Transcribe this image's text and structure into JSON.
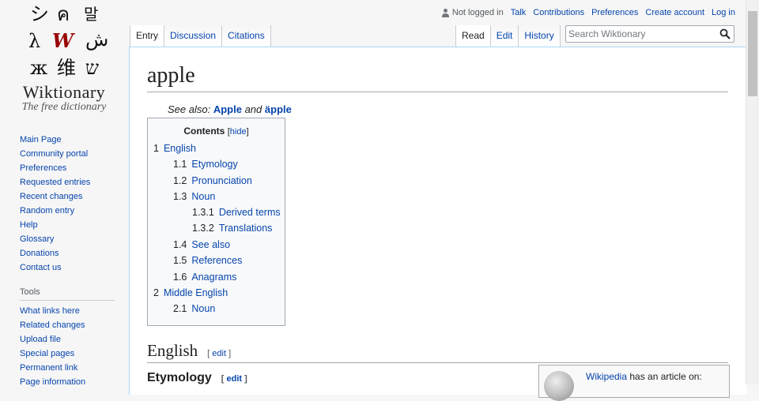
{
  "logo": {
    "glyphs": [
      "シ",
      "ค",
      "말",
      "λ",
      "W",
      "ش",
      "ж",
      "维",
      "ש"
    ],
    "wordmark": "Wiktionary",
    "tagline": "The free dictionary"
  },
  "sidebar": {
    "nav": [
      "Main Page",
      "Community portal",
      "Preferences",
      "Requested entries",
      "Recent changes",
      "Random entry",
      "Help",
      "Glossary",
      "Donations",
      "Contact us"
    ],
    "tools_heading": "Tools",
    "tools": [
      "What links here",
      "Related changes",
      "Upload file",
      "Special pages",
      "Permanent link",
      "Page information"
    ]
  },
  "personal": {
    "not_logged_in": "Not logged in",
    "talk": "Talk",
    "contributions": "Contributions",
    "preferences": "Preferences",
    "create_account": "Create account",
    "log_in": "Log in"
  },
  "tabs": {
    "left": [
      "Entry",
      "Discussion",
      "Citations"
    ],
    "right": [
      "Read",
      "Edit",
      "History"
    ]
  },
  "search": {
    "placeholder": "Search Wiktionary"
  },
  "page": {
    "title": "apple",
    "see_also_prefix": "See also:",
    "see_also_1": "Apple",
    "see_also_and": "and",
    "see_also_2": "äpple"
  },
  "toc": {
    "title": "Contents",
    "hide": "hide",
    "entries": [
      {
        "num": "1",
        "label": "English"
      },
      {
        "num": "1.1",
        "label": "Etymology"
      },
      {
        "num": "1.2",
        "label": "Pronunciation"
      },
      {
        "num": "1.3",
        "label": "Noun"
      },
      {
        "num": "1.3.1",
        "label": "Derived terms"
      },
      {
        "num": "1.3.2",
        "label": "Translations"
      },
      {
        "num": "1.4",
        "label": "See also"
      },
      {
        "num": "1.5",
        "label": "References"
      },
      {
        "num": "1.6",
        "label": "Anagrams"
      },
      {
        "num": "2",
        "label": "Middle English"
      },
      {
        "num": "2.1",
        "label": "Noun"
      }
    ]
  },
  "sections": {
    "english": "English",
    "etymology": "Etymology",
    "edit": "edit"
  },
  "wikipedia_box": {
    "link": "Wikipedia",
    "text": "has an article on:"
  },
  "colors": {
    "link": "#0645ad",
    "tab_border": "#a7d7f9",
    "background": "#f6f6f6"
  }
}
